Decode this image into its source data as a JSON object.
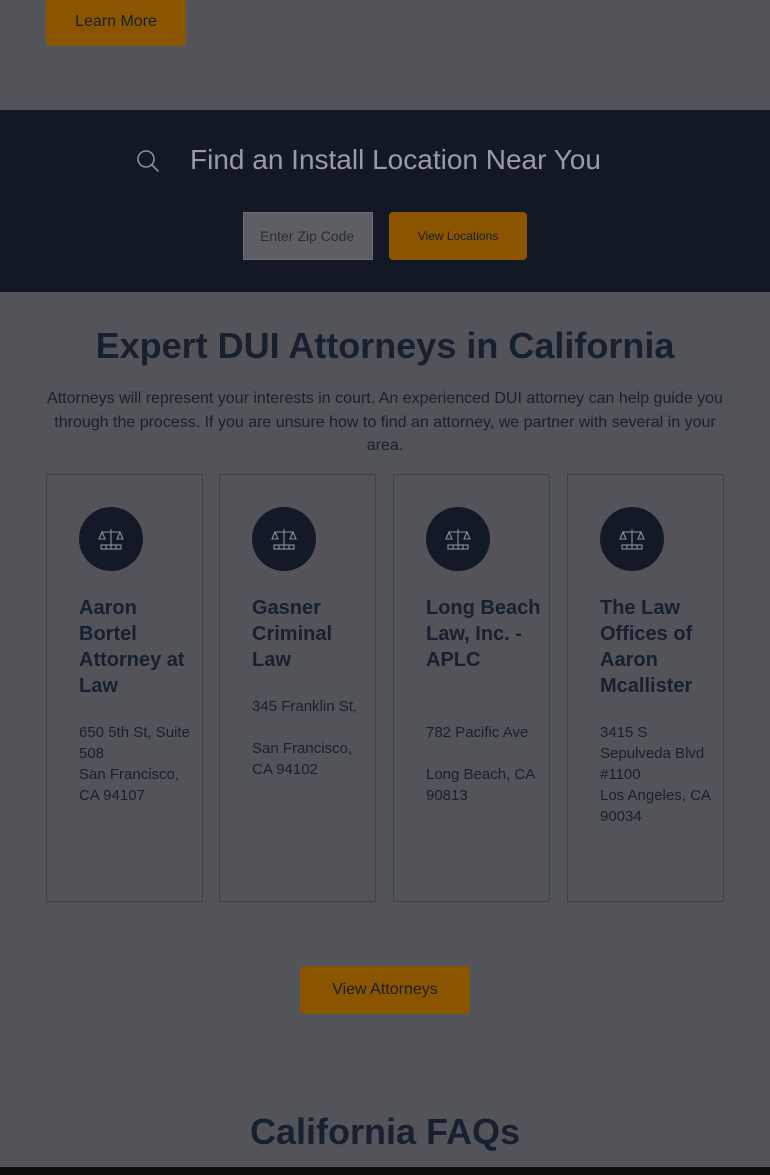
{
  "hero": {
    "learn_more_label": "Learn More"
  },
  "search": {
    "title": "Find an Install Location Near You",
    "zip_placeholder": "Enter Zip Code",
    "zip_value": "",
    "button_label": "View Locations"
  },
  "attorneys": {
    "title": "Expert DUI Attorneys in California",
    "intro": "Attorneys will represent your interests in court. An experienced DUI attorney can help guide you through the process. If you are unsure how to find an attorney, we partner with several in your area.",
    "cards": [
      {
        "name": "Aaron Bortel Attorney at Law",
        "address_line1": "650 5th St, Suite 508",
        "address_line2": "San Francisco, CA 94107",
        "icon": "scales-of-justice-icon"
      },
      {
        "name": "Gasner Criminal Law",
        "address_line1": "345 Franklin St,",
        "address_line2": "San Francisco, CA 94102",
        "icon": "scales-of-justice-icon"
      },
      {
        "name": "Long Beach Law, Inc. - APLC",
        "address_line1": "782 Pacific Ave",
        "address_line2": "Long Beach, CA 90813",
        "icon": "scales-of-justice-icon"
      },
      {
        "name": "The Law Offices of Aaron Mcallister",
        "address_line1": "3415 S Sepulveda Blvd #1100",
        "address_line2": "Los Angeles, CA 90034",
        "icon": "scales-of-justice-icon"
      }
    ],
    "view_all_label": "View Attorneys"
  },
  "faq": {
    "title": "California FAQs"
  },
  "colors": {
    "accent": "#8a5400",
    "navy": "#121824",
    "overlay_background": "#525459"
  }
}
